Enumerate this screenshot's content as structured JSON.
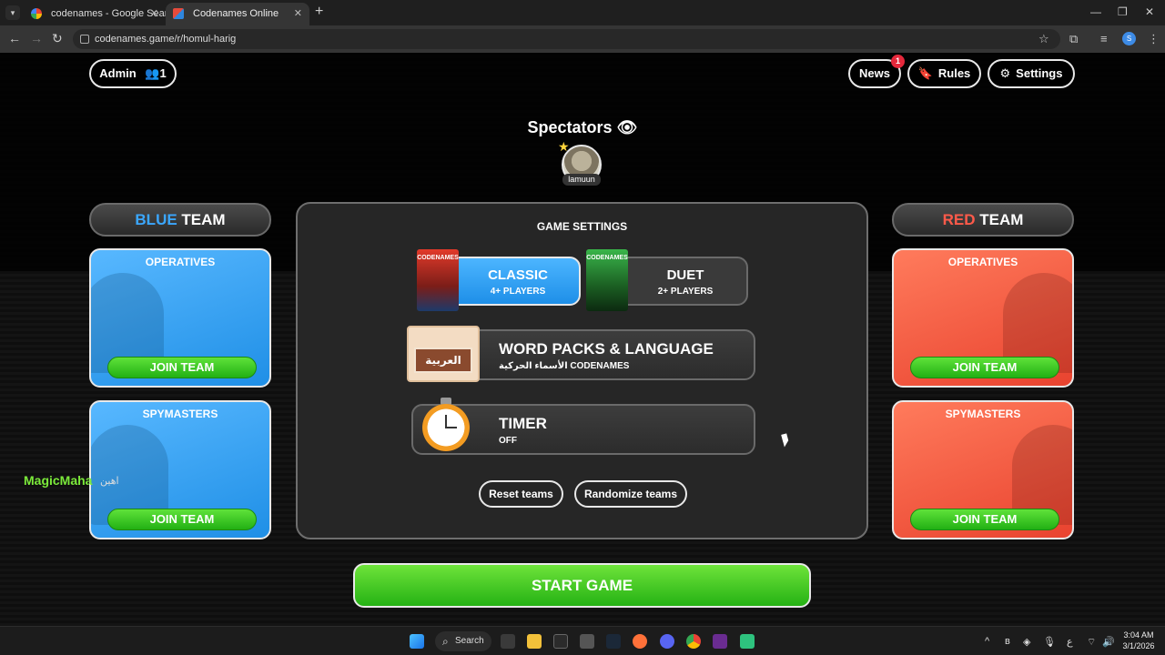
{
  "browser": {
    "tabs": [
      {
        "title": "codenames - Google Search",
        "active": false
      },
      {
        "title": "Codenames Online",
        "active": true
      }
    ],
    "url": "codenames.game/r/homul-harig",
    "profile_initial": "S"
  },
  "header": {
    "admin_label": "Admin",
    "player_count": "1",
    "news_label": "News",
    "news_badge": "1",
    "rules_label": "Rules",
    "settings_label": "Settings"
  },
  "spectators": {
    "title": "Spectators",
    "players": [
      {
        "name": "lamuun"
      }
    ]
  },
  "blue_team": {
    "color_word": "BLUE",
    "team_word": "TEAM",
    "operatives": {
      "title": "OPERATIVES",
      "join_label": "JOIN TEAM"
    },
    "spymasters": {
      "title": "SPYMASTERS",
      "join_label": "JOIN TEAM"
    }
  },
  "red_team": {
    "color_word": "RED",
    "team_word": "TEAM",
    "operatives": {
      "title": "OPERATIVES",
      "join_label": "JOIN TEAM"
    },
    "spymasters": {
      "title": "SPYMASTERS",
      "join_label": "JOIN TEAM"
    }
  },
  "game_settings": {
    "title": "GAME SETTINGS",
    "modes": [
      {
        "name": "CLASSIC",
        "subtitle": "4+ PLAYERS",
        "box_text": "CODENAMES",
        "selected": true
      },
      {
        "name": "DUET",
        "subtitle": "2+ PLAYERS",
        "box_text": "CODENAMES",
        "selected": false
      }
    ],
    "word_packs": {
      "title": "WORD PACKS & LANGUAGE",
      "subtitle": "الأسماء الحركية CODENAMES",
      "card_label": "العربية"
    },
    "timer": {
      "title": "TIMER",
      "subtitle": "OFF"
    },
    "reset_label": "Reset teams",
    "randomize_label": "Randomize teams"
  },
  "start_label": "START GAME",
  "overlay": {
    "name": "MagicMaha",
    "arabic_text": "اهين"
  },
  "taskbar": {
    "search_label": "Search",
    "time": "3:04 AM",
    "date": "3/1/2026",
    "lang": "ع"
  },
  "colors": {
    "blue": "#3ba7ff",
    "red": "#ff5a4a",
    "green": "#25b214",
    "badge_red": "#e5283b"
  }
}
